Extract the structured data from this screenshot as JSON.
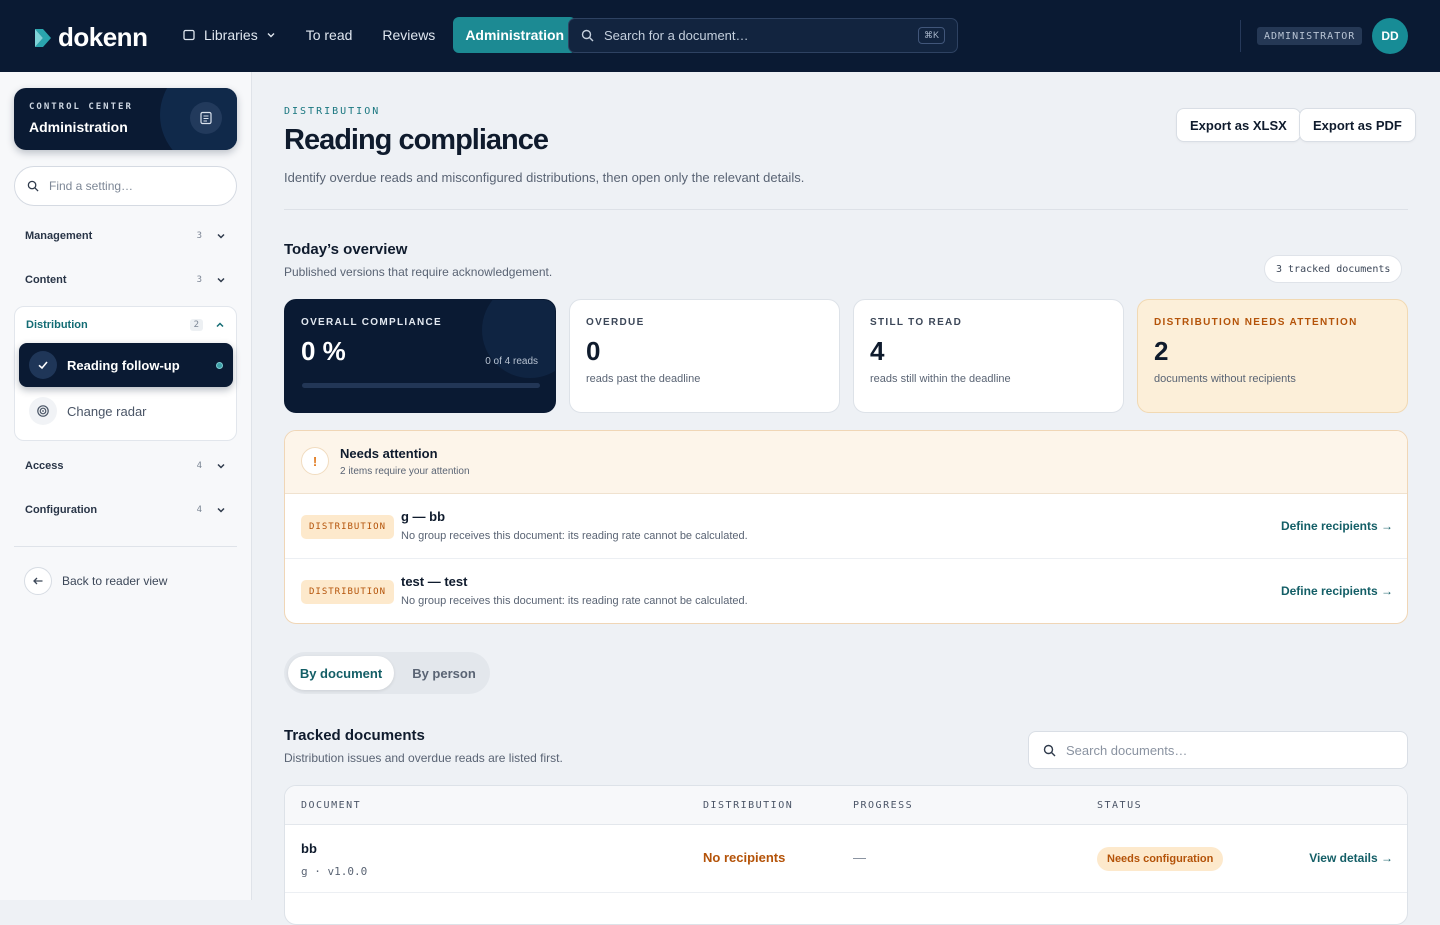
{
  "app": {
    "logo_text": "dokenn"
  },
  "topnav": {
    "libraries": "Libraries",
    "to_read": "To read",
    "reviews": "Reviews",
    "administration": "Administration",
    "search_placeholder": "Search for a document…",
    "search_shortcut": "⌘K",
    "role": "ADMINISTRATOR",
    "avatar_initials": "DD"
  },
  "sidebar": {
    "control_center_label": "CONTROL CENTER",
    "control_center_title": "Administration",
    "search_placeholder": "Find a setting…",
    "groups": [
      {
        "label": "Management",
        "count": "3"
      },
      {
        "label": "Content",
        "count": "3"
      },
      {
        "label": "Distribution",
        "count": "2"
      },
      {
        "label": "Access",
        "count": "4"
      },
      {
        "label": "Configuration",
        "count": "4"
      }
    ],
    "distribution_items": [
      {
        "label": "Reading follow-up"
      },
      {
        "label": "Change radar"
      }
    ],
    "back_label": "Back to reader view"
  },
  "page": {
    "eyebrow": "DISTRIBUTION",
    "title": "Reading compliance",
    "description": "Identify overdue reads and misconfigured distributions, then open only the relevant details.",
    "export_xlsx": "Export as XLSX",
    "export_pdf": "Export as PDF"
  },
  "overview": {
    "title": "Today’s overview",
    "subtitle": "Published versions that require acknowledgement.",
    "tracked_pill": "3 tracked documents",
    "cards": [
      {
        "label": "OVERALL COMPLIANCE",
        "value": "0 %",
        "note": "0 of 4 reads",
        "progress": 0
      },
      {
        "label": "OVERDUE",
        "value": "0",
        "note": "reads past the deadline"
      },
      {
        "label": "STILL TO READ",
        "value": "4",
        "note": "reads still within the deadline"
      },
      {
        "label": "DISTRIBUTION NEEDS ATTENTION",
        "value": "2",
        "note": "documents without recipients"
      }
    ]
  },
  "attention": {
    "icon": "!",
    "title": "Needs attention",
    "subtitle": "2 items require your attention",
    "items": [
      {
        "tag": "DISTRIBUTION",
        "title": "g — bb",
        "desc": "No group receives this document: its reading rate cannot be calculated.",
        "link": "Define recipients →"
      },
      {
        "tag": "DISTRIBUTION",
        "title": "test — test",
        "desc": "No group receives this document: its reading rate cannot be calculated.",
        "link": "Define recipients →"
      }
    ]
  },
  "tabs": {
    "by_document": "By document",
    "by_person": "By person"
  },
  "tracked": {
    "title": "Tracked documents",
    "subtitle": "Distribution issues and overdue reads are listed first.",
    "search_placeholder": "Search documents…",
    "columns": [
      "DOCUMENT",
      "DISTRIBUTION",
      "PROGRESS",
      "STATUS"
    ],
    "rows": [
      {
        "title": "bb",
        "meta": "g · v1.0.0",
        "distribution": "No recipients",
        "progress": "—",
        "status": "Needs configuration",
        "link": "View details →"
      }
    ]
  },
  "colors": {
    "navy": "#0a1a33",
    "teal": "#1c8a93",
    "warning": "#b45309"
  }
}
